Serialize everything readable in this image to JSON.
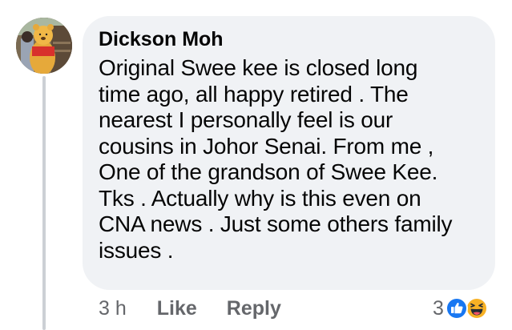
{
  "comment": {
    "author": "Dickson Moh",
    "lines": [
      "Original Swee kee is closed long",
      "time ago, all happy retired . The",
      "nearest I personally feel is our",
      "cousins in Johor Senai. From me ,",
      "One of the grandson of Swee Kee.",
      "Tks . Actually why is this even on",
      "CNA news . Just some others family",
      "issues ."
    ]
  },
  "actions": {
    "time": "3 h",
    "like_label": "Like",
    "reply_label": "Reply"
  },
  "reactions": {
    "count": "3",
    "icons": [
      "like-reaction-icon",
      "haha-reaction-icon"
    ]
  },
  "colors": {
    "bubble_background": "#f0f2f5",
    "secondary_text": "#65676b",
    "like_blue": "#1877f2",
    "haha_yellow": "#f7b125"
  }
}
